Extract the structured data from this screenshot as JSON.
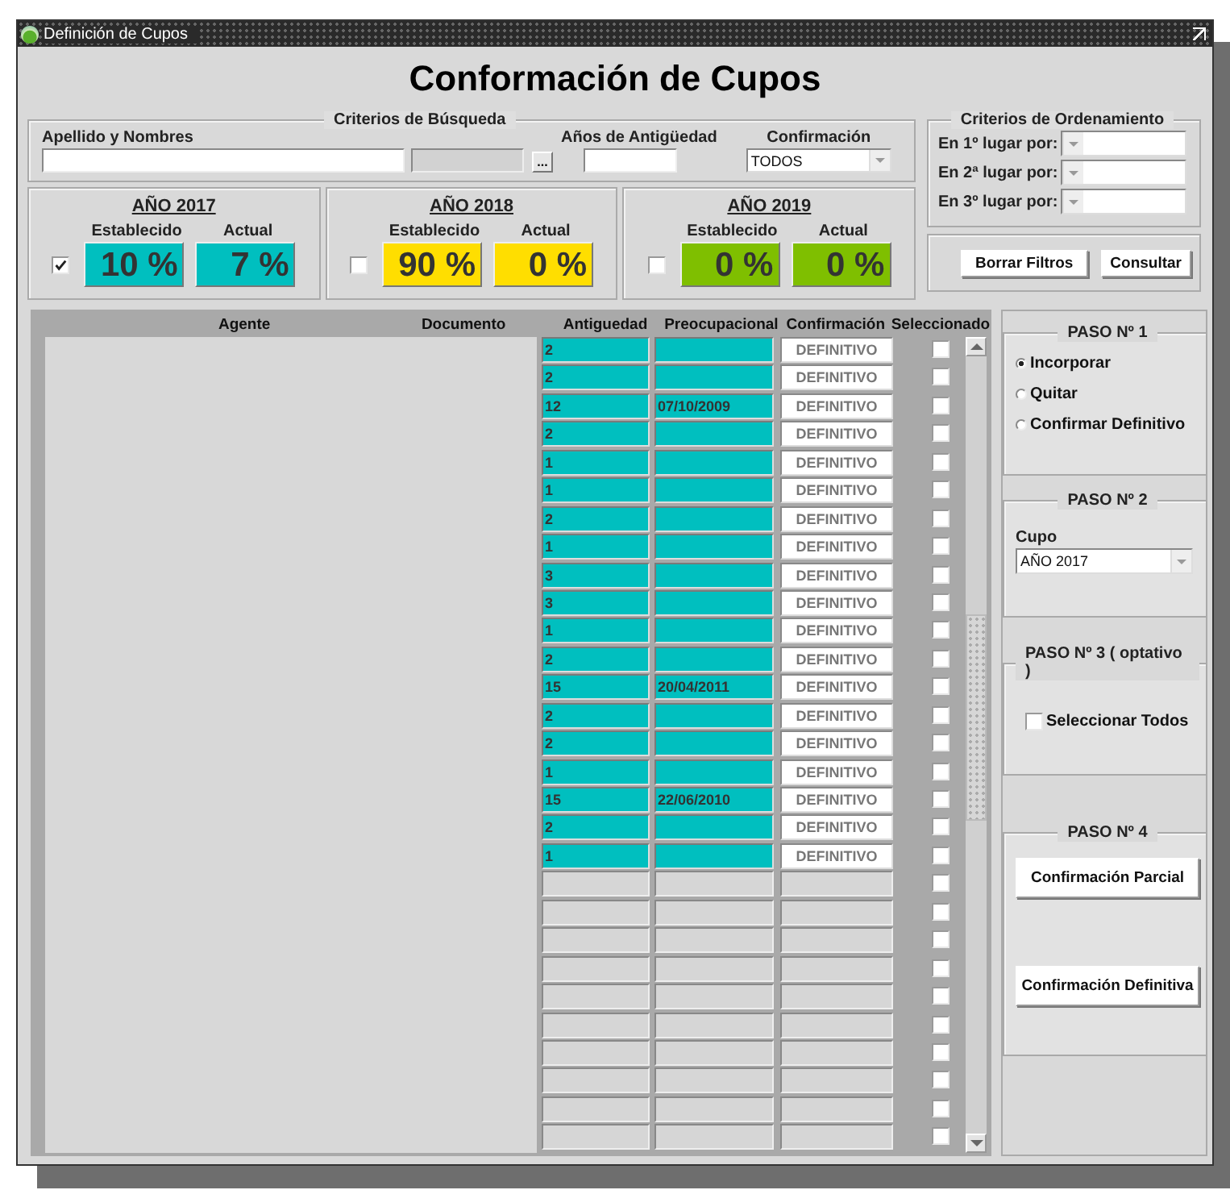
{
  "window": {
    "title": "Definición de Cupos"
  },
  "heading": "Conformación de Cupos",
  "search": {
    "title": "Criterios de Búsqueda",
    "name_label": "Apellido y Nombres",
    "lookup_button": "...",
    "years_label": "Años de Antigüedad",
    "confirmation_label": "Confirmación",
    "confirmation_value": "TODOS"
  },
  "years": [
    {
      "title": "AÑO 2017",
      "checked": true,
      "established_label": "Establecido",
      "current_label": "Actual",
      "established": "10 %",
      "current": "7 %",
      "color": "#00bfbf"
    },
    {
      "title": "AÑO 2018",
      "checked": false,
      "established_label": "Establecido",
      "current_label": "Actual",
      "established": "90 %",
      "current": "0 %",
      "color": "#ffde00"
    },
    {
      "title": "AÑO 2019",
      "checked": false,
      "established_label": "Establecido",
      "current_label": "Actual",
      "established": "0 %",
      "current": "0 %",
      "color": "#7fbf00"
    }
  ],
  "ordering": {
    "title": "Criterios de Ordenamiento",
    "rows": [
      {
        "label": "En 1º lugar por:"
      },
      {
        "label": "En 2ª lugar por:"
      },
      {
        "label": "En 3º lugar por:"
      }
    ]
  },
  "filter_buttons": [
    "Borrar Filtros",
    "Consultar"
  ],
  "table": {
    "columns": [
      "Agente",
      "Documento",
      "Antiguedad",
      "Preocupacional",
      "Confirmación",
      "Seleccionado"
    ],
    "rows": [
      {
        "kind": "filled",
        "antiguedad": "2",
        "confirmacion": "DEFINITIVO",
        "selected": false
      },
      {
        "kind": "filled",
        "antiguedad": "2",
        "confirmacion": "DEFINITIVO",
        "selected": false
      },
      {
        "kind": "filled",
        "antiguedad": "12",
        "preocupacional": "07/10/2009",
        "confirmacion": "DEFINITIVO",
        "selected": false
      },
      {
        "kind": "filled",
        "antiguedad": "2",
        "confirmacion": "DEFINITIVO",
        "selected": false
      },
      {
        "kind": "filled",
        "antiguedad": "1",
        "confirmacion": "DEFINITIVO",
        "selected": false
      },
      {
        "kind": "filled",
        "antiguedad": "1",
        "confirmacion": "DEFINITIVO",
        "selected": false
      },
      {
        "kind": "filled",
        "antiguedad": "2",
        "confirmacion": "DEFINITIVO",
        "selected": false
      },
      {
        "kind": "filled",
        "antiguedad": "1",
        "confirmacion": "DEFINITIVO",
        "selected": false
      },
      {
        "kind": "filled",
        "antiguedad": "3",
        "confirmacion": "DEFINITIVO",
        "selected": false
      },
      {
        "kind": "filled",
        "antiguedad": "3",
        "confirmacion": "DEFINITIVO",
        "selected": false
      },
      {
        "kind": "filled",
        "antiguedad": "1",
        "confirmacion": "DEFINITIVO",
        "selected": false
      },
      {
        "kind": "filled",
        "antiguedad": "2",
        "confirmacion": "DEFINITIVO",
        "selected": false
      },
      {
        "kind": "filled",
        "antiguedad": "15",
        "preocupacional": "20/04/2011",
        "confirmacion": "DEFINITIVO",
        "selected": false
      },
      {
        "kind": "filled",
        "antiguedad": "2",
        "confirmacion": "DEFINITIVO",
        "selected": false
      },
      {
        "kind": "filled",
        "antiguedad": "2",
        "confirmacion": "DEFINITIVO",
        "selected": false
      },
      {
        "kind": "filled",
        "antiguedad": "1",
        "confirmacion": "DEFINITIVO",
        "selected": false
      },
      {
        "kind": "filled",
        "antiguedad": "15",
        "preocupacional": "22/06/2010",
        "confirmacion": "DEFINITIVO",
        "selected": false
      },
      {
        "kind": "filled",
        "antiguedad": "2",
        "confirmacion": "DEFINITIVO",
        "selected": false
      },
      {
        "kind": "filled",
        "antiguedad": "1",
        "confirmacion": "DEFINITIVO",
        "selected": false
      },
      {
        "kind": "empty",
        "selected": false
      },
      {
        "kind": "empty",
        "selected": false
      },
      {
        "kind": "empty",
        "selected": false
      },
      {
        "kind": "empty",
        "selected": false
      },
      {
        "kind": "empty",
        "selected": false
      },
      {
        "kind": "empty",
        "selected": false
      },
      {
        "kind": "empty",
        "selected": false
      },
      {
        "kind": "empty",
        "selected": false
      },
      {
        "kind": "empty",
        "selected": false
      },
      {
        "kind": "empty",
        "selected": false
      }
    ]
  },
  "steps": [
    {
      "kind": "radios",
      "title": "PASO Nº 1",
      "options": [
        {
          "label": "Incorporar",
          "selected": true
        },
        {
          "label": "Quitar",
          "selected": false
        },
        {
          "label": "Confirmar Definitivo",
          "selected": false
        }
      ]
    },
    {
      "kind": "select",
      "title": "PASO Nº 2",
      "label": "Cupo",
      "value": "AÑO 2017"
    },
    {
      "kind": "checkbox",
      "title": "PASO Nº 3 ( optativo )",
      "label": "Seleccionar Todos",
      "checked": false
    },
    {
      "kind": "buttons",
      "title": "PASO Nº 4",
      "buttons": [
        "Confirmación Parcial",
        "Confirmación Definitiva"
      ]
    }
  ]
}
